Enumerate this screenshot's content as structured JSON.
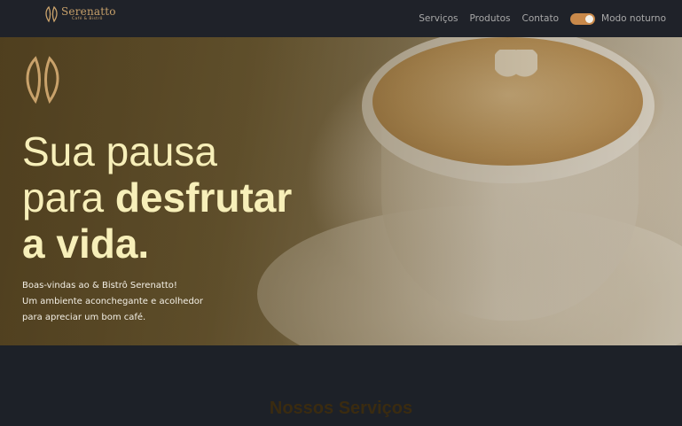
{
  "header": {
    "logo_name": "Serenatto",
    "logo_sub": "Café & Bistrô",
    "nav": [
      {
        "label": "Serviços"
      },
      {
        "label": "Produtos"
      },
      {
        "label": "Contato"
      }
    ],
    "dark_mode": {
      "label": "Modo noturno",
      "on": true
    }
  },
  "hero": {
    "title_line1": "Sua pausa",
    "title_line2_regular": "para ",
    "title_line2_bold": "desfrutar",
    "title_line3": "a vida.",
    "desc_line1": "Boas-vindas ao & Bistrô Serenatto!",
    "desc_line2": "Um ambiente aconchegante e acolhedor",
    "desc_line3": "para apreciar um bom café."
  },
  "services": {
    "title": "Nossos Serviços"
  },
  "colors": {
    "accent": "#c9894a",
    "title": "#f7efb9",
    "header_bg": "#1f2229"
  }
}
